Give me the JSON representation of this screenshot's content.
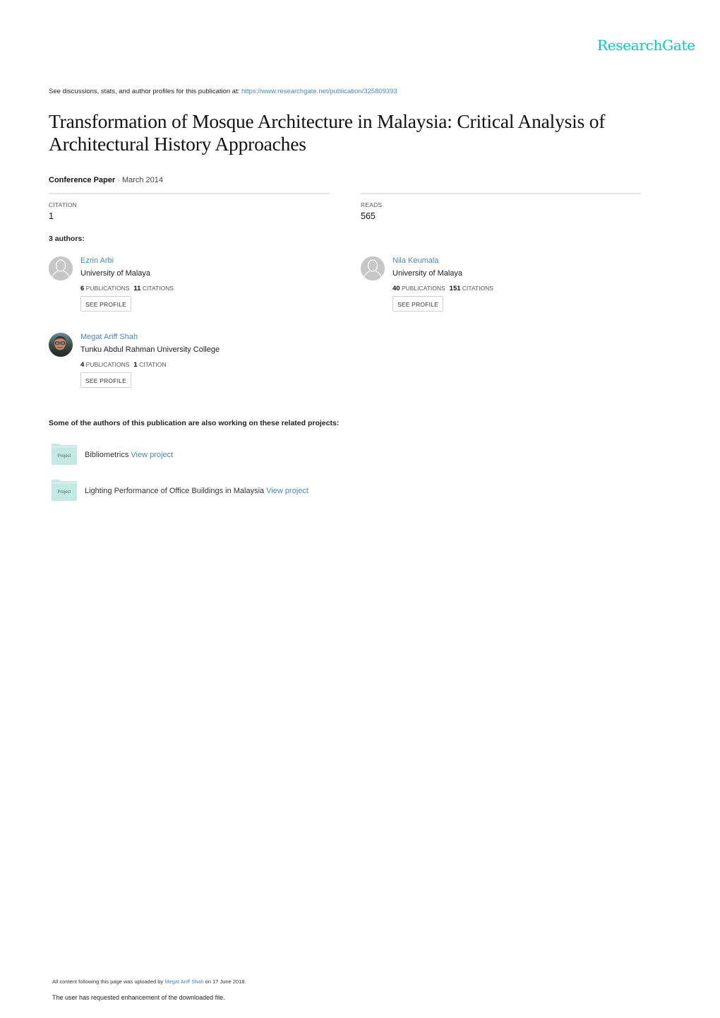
{
  "brand": {
    "logo_text": "ResearchGate",
    "accent": "#00ccbb",
    "link_color": "#4a86b4"
  },
  "header": {
    "discussion_prefix": "See discussions, stats, and author profiles for this publication at: ",
    "publication_url": "https://www.researchgate.net/publication/325809393"
  },
  "publication": {
    "title": "Transformation of Mosque Architecture in Malaysia: Critical Analysis of Architectural History Approaches",
    "type": "Conference Paper",
    "separator": " · ",
    "date": "March 2014"
  },
  "stats": {
    "citation_label": "CITATION",
    "citation_value": "1",
    "reads_label": "READS",
    "reads_value": "565"
  },
  "authors_heading": "3 authors:",
  "authors": [
    {
      "name": "Ezrin Arbi",
      "institution": "University of Malaya",
      "publications": "6",
      "publications_label": "PUBLICATIONS",
      "citations": "11",
      "citations_label": "CITATIONS",
      "button": "SEE PROFILE",
      "avatar": "default-avatar"
    },
    {
      "name": "Nila Keumala",
      "institution": "University of Malaya",
      "publications": "40",
      "publications_label": "PUBLICATIONS",
      "citations": "151",
      "citations_label": "CITATIONS",
      "button": "SEE PROFILE",
      "avatar": "default-avatar"
    },
    {
      "name": "Megat Ariff Shah",
      "institution": "Tunku Abdul Rahman University College",
      "publications": "4",
      "publications_label": "PUBLICATIONS",
      "citations": "1",
      "citations_label": "CITATION",
      "button": "SEE PROFILE",
      "avatar": "photo-avatar"
    }
  ],
  "projects_heading": "Some of the authors of this publication are also working on these related projects:",
  "projects": [
    {
      "icon_label": "Project",
      "name": "Bibliometrics",
      "link": "View project"
    },
    {
      "icon_label": "Project",
      "name": "Lighting Performance of Office Buildings in Malaysia",
      "link": "View project"
    }
  ],
  "footer": {
    "upload_prefix": "All content following this page was uploaded by ",
    "uploader": "Megat Ariff Shah",
    "upload_suffix": " on 17 June 2018.",
    "enhancement_note": "The user has requested enhancement of the downloaded file."
  }
}
